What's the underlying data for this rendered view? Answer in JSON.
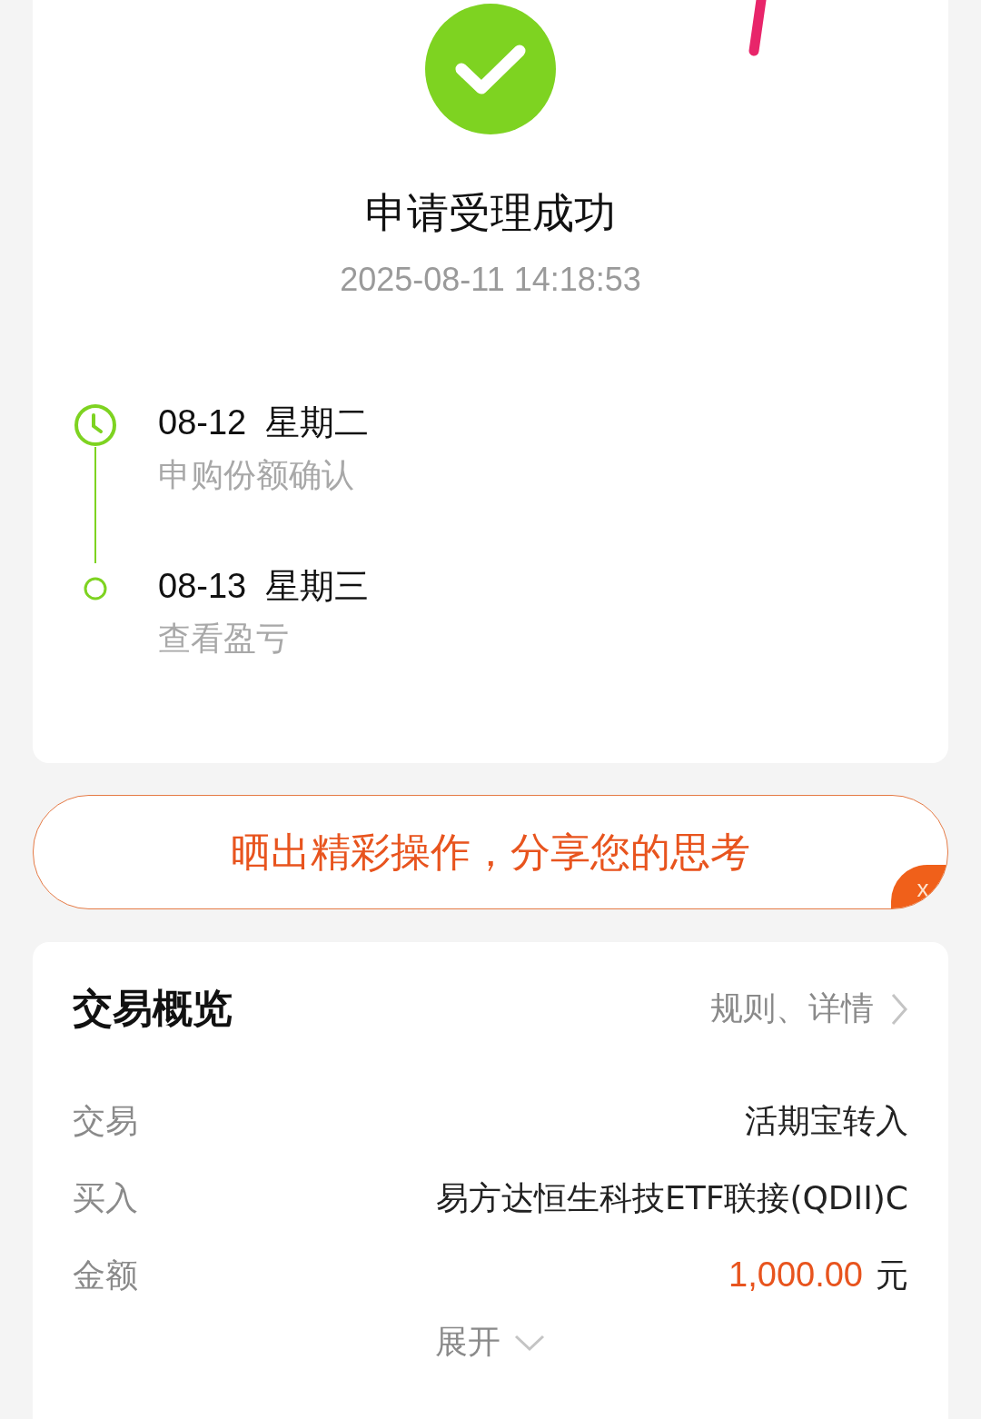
{
  "result": {
    "title": "申请受理成功",
    "time": "2025-08-11 14:18:53"
  },
  "timeline": [
    {
      "date": "08-12  星期二",
      "desc": "申购份额确认",
      "kind": "current"
    },
    {
      "date": "08-13  星期三",
      "desc": "查看盈亏",
      "kind": "pending"
    }
  ],
  "share_banner": {
    "text": "晒出精彩操作，分享您的思考",
    "close": "x"
  },
  "overview": {
    "title": "交易概览",
    "link": "规则、详情",
    "rows": [
      {
        "label": "交易",
        "value": "活期宝转入",
        "kind": "text"
      },
      {
        "label": "买入",
        "value": "易方达恒生科技ETF联接(QDII)C",
        "kind": "text"
      },
      {
        "label": "金额",
        "value": "1,000.00",
        "unit": "元",
        "kind": "amount"
      }
    ],
    "expand": "展开"
  }
}
